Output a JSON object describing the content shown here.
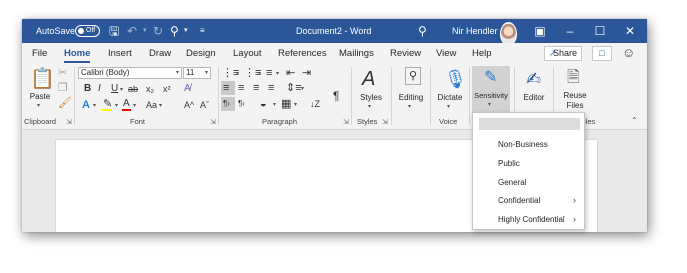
{
  "titlebar": {
    "autosave_label": "AutoSave",
    "autosave_state": "Off",
    "doc_title": "Document2 - Word",
    "user_name": "Nir Hendler",
    "color": "#2b579a"
  },
  "tabs": [
    "File",
    "Home",
    "Insert",
    "Draw",
    "Design",
    "Layout",
    "References",
    "Mailings",
    "Review",
    "View",
    "Help"
  ],
  "active_tab": "Home",
  "share_label": "Share",
  "ribbon": {
    "clipboard": {
      "paste_label": "Paste",
      "group_label": "Clipboard"
    },
    "font": {
      "font_name": "Calibri (Body)",
      "font_size": "11",
      "bold": "B",
      "italic": "I",
      "underline": "U",
      "subscript": "x₂",
      "superscript": "x²",
      "grow_font": "A^",
      "shrink_font": "Aˇ",
      "change_case": "Aa",
      "group_label": "Font"
    },
    "paragraph": {
      "group_label": "Paragraph"
    },
    "styles": {
      "label": "Styles",
      "group_label": "Styles"
    },
    "editing": {
      "label": "Editing"
    },
    "voice": {
      "dictate_label": "Dictate",
      "group_label": "Voice"
    },
    "sensitivity": {
      "label": "Sensitivity"
    },
    "editor": {
      "label": "Editor"
    },
    "reuse": {
      "label_line1": "Reuse",
      "label_line2": "Files",
      "group_label_fragment": "iles"
    }
  },
  "sensitivity_menu": {
    "items": [
      {
        "label": "Non-Business",
        "has_submenu": false
      },
      {
        "label": "Public",
        "has_submenu": false
      },
      {
        "label": "General",
        "has_submenu": false
      },
      {
        "label": "Confidential",
        "has_submenu": true
      },
      {
        "label": "Highly Confidential",
        "has_submenu": true
      }
    ]
  }
}
